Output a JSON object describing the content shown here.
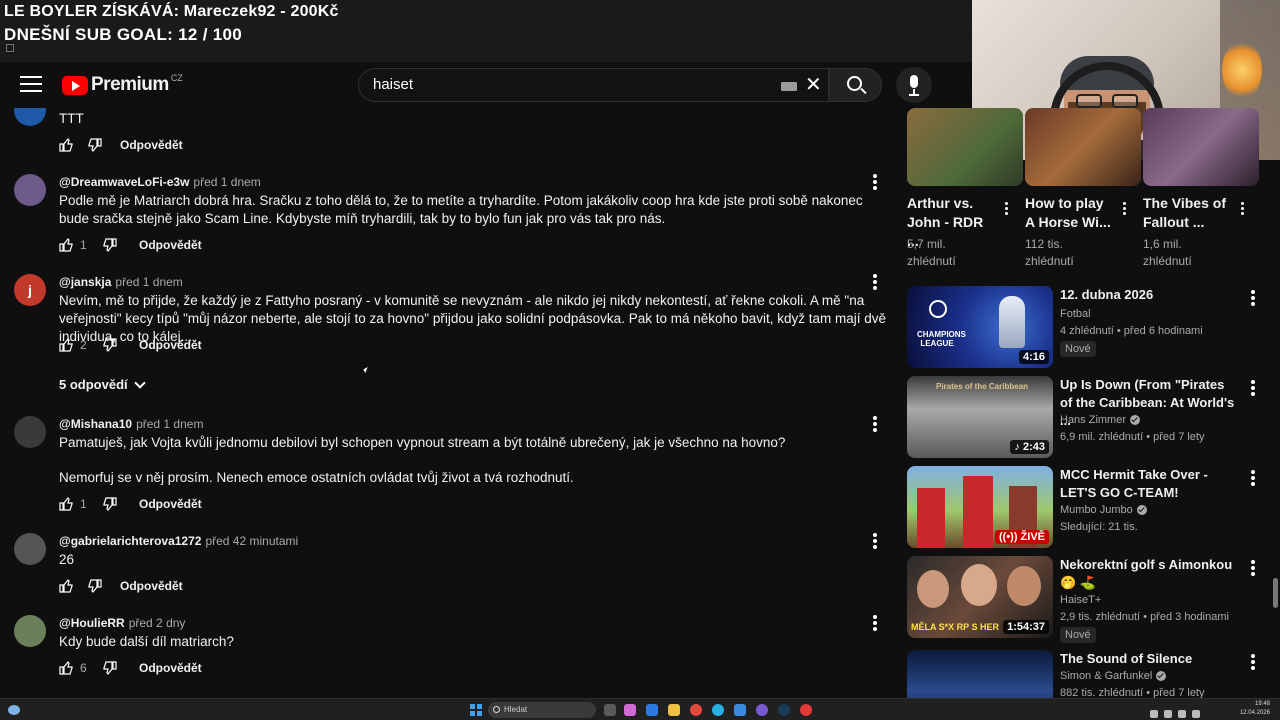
{
  "overlay": {
    "line1": "LE BOYLER ZÍSKÁVÁ: Mareczek92 - 200Kč",
    "line2": "DNEŠNÍ SUB GOAL: 12 / 100"
  },
  "header": {
    "logo_word": "Premium",
    "country": "CZ",
    "search_value": "haiset"
  },
  "comments": [
    {
      "text": "TTT",
      "likes": "",
      "reply": "Odpovědět",
      "avatar_letter": "",
      "avatar_color": "#1f5aa8"
    },
    {
      "author": "@DreamwaveLoFi-e3w",
      "time": "před 1 dnem",
      "text": "Podle mě je Matriarch dobrá hra. Sračku z toho dělá to, že to metíte a tryhardíte. Potom jakákoliv coop hra kde jste proti sobě nakonec bude sračka stejně jako Scam Line. Kdybyste míň tryhardili, tak by to bylo fun jak pro vás tak pro nás.",
      "likes": "1",
      "reply": "Odpovědět",
      "avatar_color": "#6d5a8a"
    },
    {
      "author": "@janskja",
      "time": "před 1 dnem",
      "text": "Nevím, mě to přijde, že každý je z Fattyho posraný - v komunitě se nevyznám - ale nikdo jej nikdy nekontestí, ať řekne cokoli. A mě \"na veřejnosti\" kecy típů \"můj názor neberte, ale stojí to za hovno\" přijdou jako solidní podpásovka. Pak to má někoho bavit, když tam mají dvě individua, co to kálej...",
      "likes": "2",
      "reply": "Odpovědět",
      "avatar_letter": "j",
      "avatar_color": "#c0392b"
    },
    {
      "replies_label": "5 odpovědí"
    },
    {
      "author": "@Mishana10",
      "time": "před 1 dnem",
      "text": "Pamatuješ, jak Vojta kvůli jednomu debilovi byl schopen vypnout stream a být totálně ubrečený, jak je všechno na hovno?",
      "text2": "Nemorfuj se v něj prosím. Nenech emoce ostatních ovládat tvůj život a tvá rozhodnutí.",
      "likes": "1",
      "reply": "Odpovědět",
      "avatar_color": "#3a3a3a"
    },
    {
      "author": "@gabrielarichterova1272",
      "time": "před 42 minutami",
      "text": "26",
      "likes": "",
      "reply": "Odpovědět",
      "avatar_color": "#555555"
    },
    {
      "author": "@HoulieRR",
      "time": "před 2 dny",
      "text": "Kdy bude další díl matriarch?",
      "likes": "6",
      "reply": "Odpovědět",
      "avatar_color": "#6b7f5a"
    }
  ],
  "shelf": [
    {
      "title": "Arthur vs. John - RDR ...",
      "views": "5,7 mil.",
      "views2": "zhlédnutí"
    },
    {
      "title": "How to play A Horse Wi...",
      "views": "112 tis.",
      "views2": "zhlédnutí"
    },
    {
      "title": "The Vibes of Fallout ...",
      "views": "1,6 mil.",
      "views2": "zhlédnutí"
    }
  ],
  "recs": [
    {
      "title": "12. dubna 2026",
      "channel": "Fotbal",
      "meta": "4 zhlédnutí • před 6 hodinami",
      "badge": "Nové",
      "duration": "4:16",
      "thumb_label": "CHAMPIONS LEAGUE"
    },
    {
      "title": "Up Is Down (From \"Pirates of the Caribbean: At World's ...",
      "channel": "Hans Zimmer",
      "meta": "6,9 mil. zhlédnutí • před 7 lety",
      "duration": "2:43",
      "thumb_label": "Pirates of the Caribbean"
    },
    {
      "title": "MCC Hermit Take Over - LET'S GO C-TEAM!",
      "channel": "Mumbo Jumbo",
      "meta": "Sledující: 21 tis.",
      "live": "ŽIVĚ"
    },
    {
      "title": "Nekorektní golf s Aimonkou 🤭 ⛳",
      "channel": "HaiseT+",
      "meta": "2,9 tis. zhlédnutí • před 3 hodinami",
      "badge": "Nové",
      "duration": "1:54:37",
      "thumb_label": "MĚLA S*X RP S HER"
    },
    {
      "title": "The Sound of Silence",
      "channel": "Simon & Garfunkel",
      "meta": "882 tis. zhlédnutí • před 7 lety"
    }
  ],
  "taskbar": {
    "search_placeholder": "Hledat",
    "time": "19:48",
    "date": "12.04.2026"
  }
}
